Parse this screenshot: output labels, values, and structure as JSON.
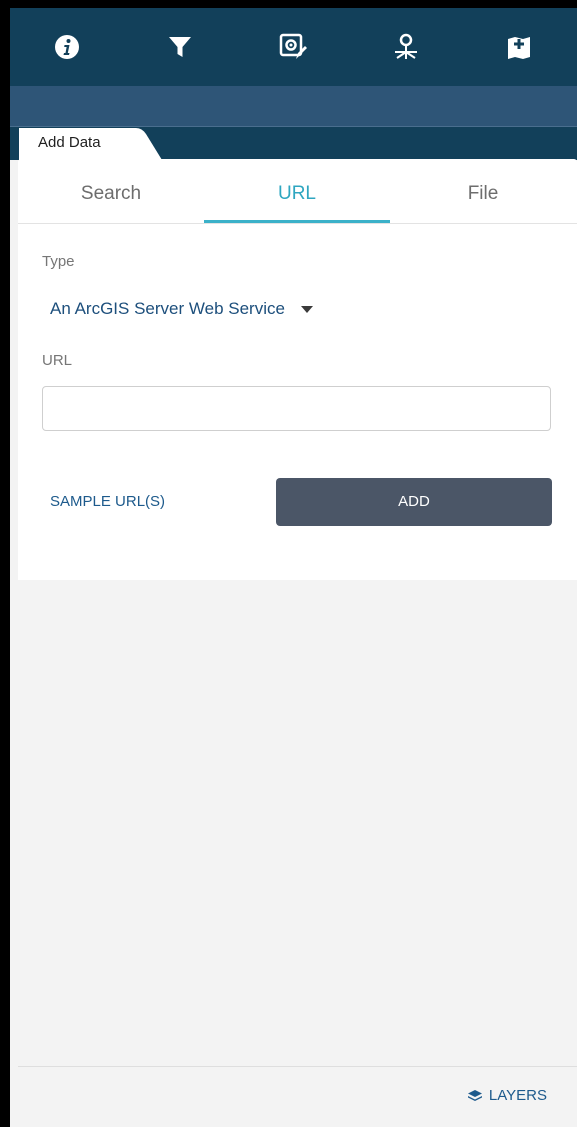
{
  "toolbar": {
    "tools": [
      {
        "icon": "info-icon"
      },
      {
        "icon": "filter-icon"
      },
      {
        "icon": "edit-settings-icon"
      },
      {
        "icon": "share-node-icon"
      },
      {
        "icon": "add-data-icon"
      }
    ]
  },
  "panel": {
    "title": "Add Data",
    "tabs": [
      {
        "label": "Search",
        "active": false
      },
      {
        "label": "URL",
        "active": true
      },
      {
        "label": "File",
        "active": false
      }
    ],
    "type_label": "Type",
    "type_value": "An ArcGIS Server Web Service",
    "url_label": "URL",
    "url_value": "",
    "url_placeholder": "",
    "sample_link": "SAMPLE URL(S)",
    "add_button": "ADD"
  },
  "footer": {
    "layers_label": "LAYERS"
  },
  "colors": {
    "header_bg": "#12405a",
    "accent": "#3bb1c9",
    "add_button_bg": "#4b5667",
    "link": "#1d5a8c"
  }
}
